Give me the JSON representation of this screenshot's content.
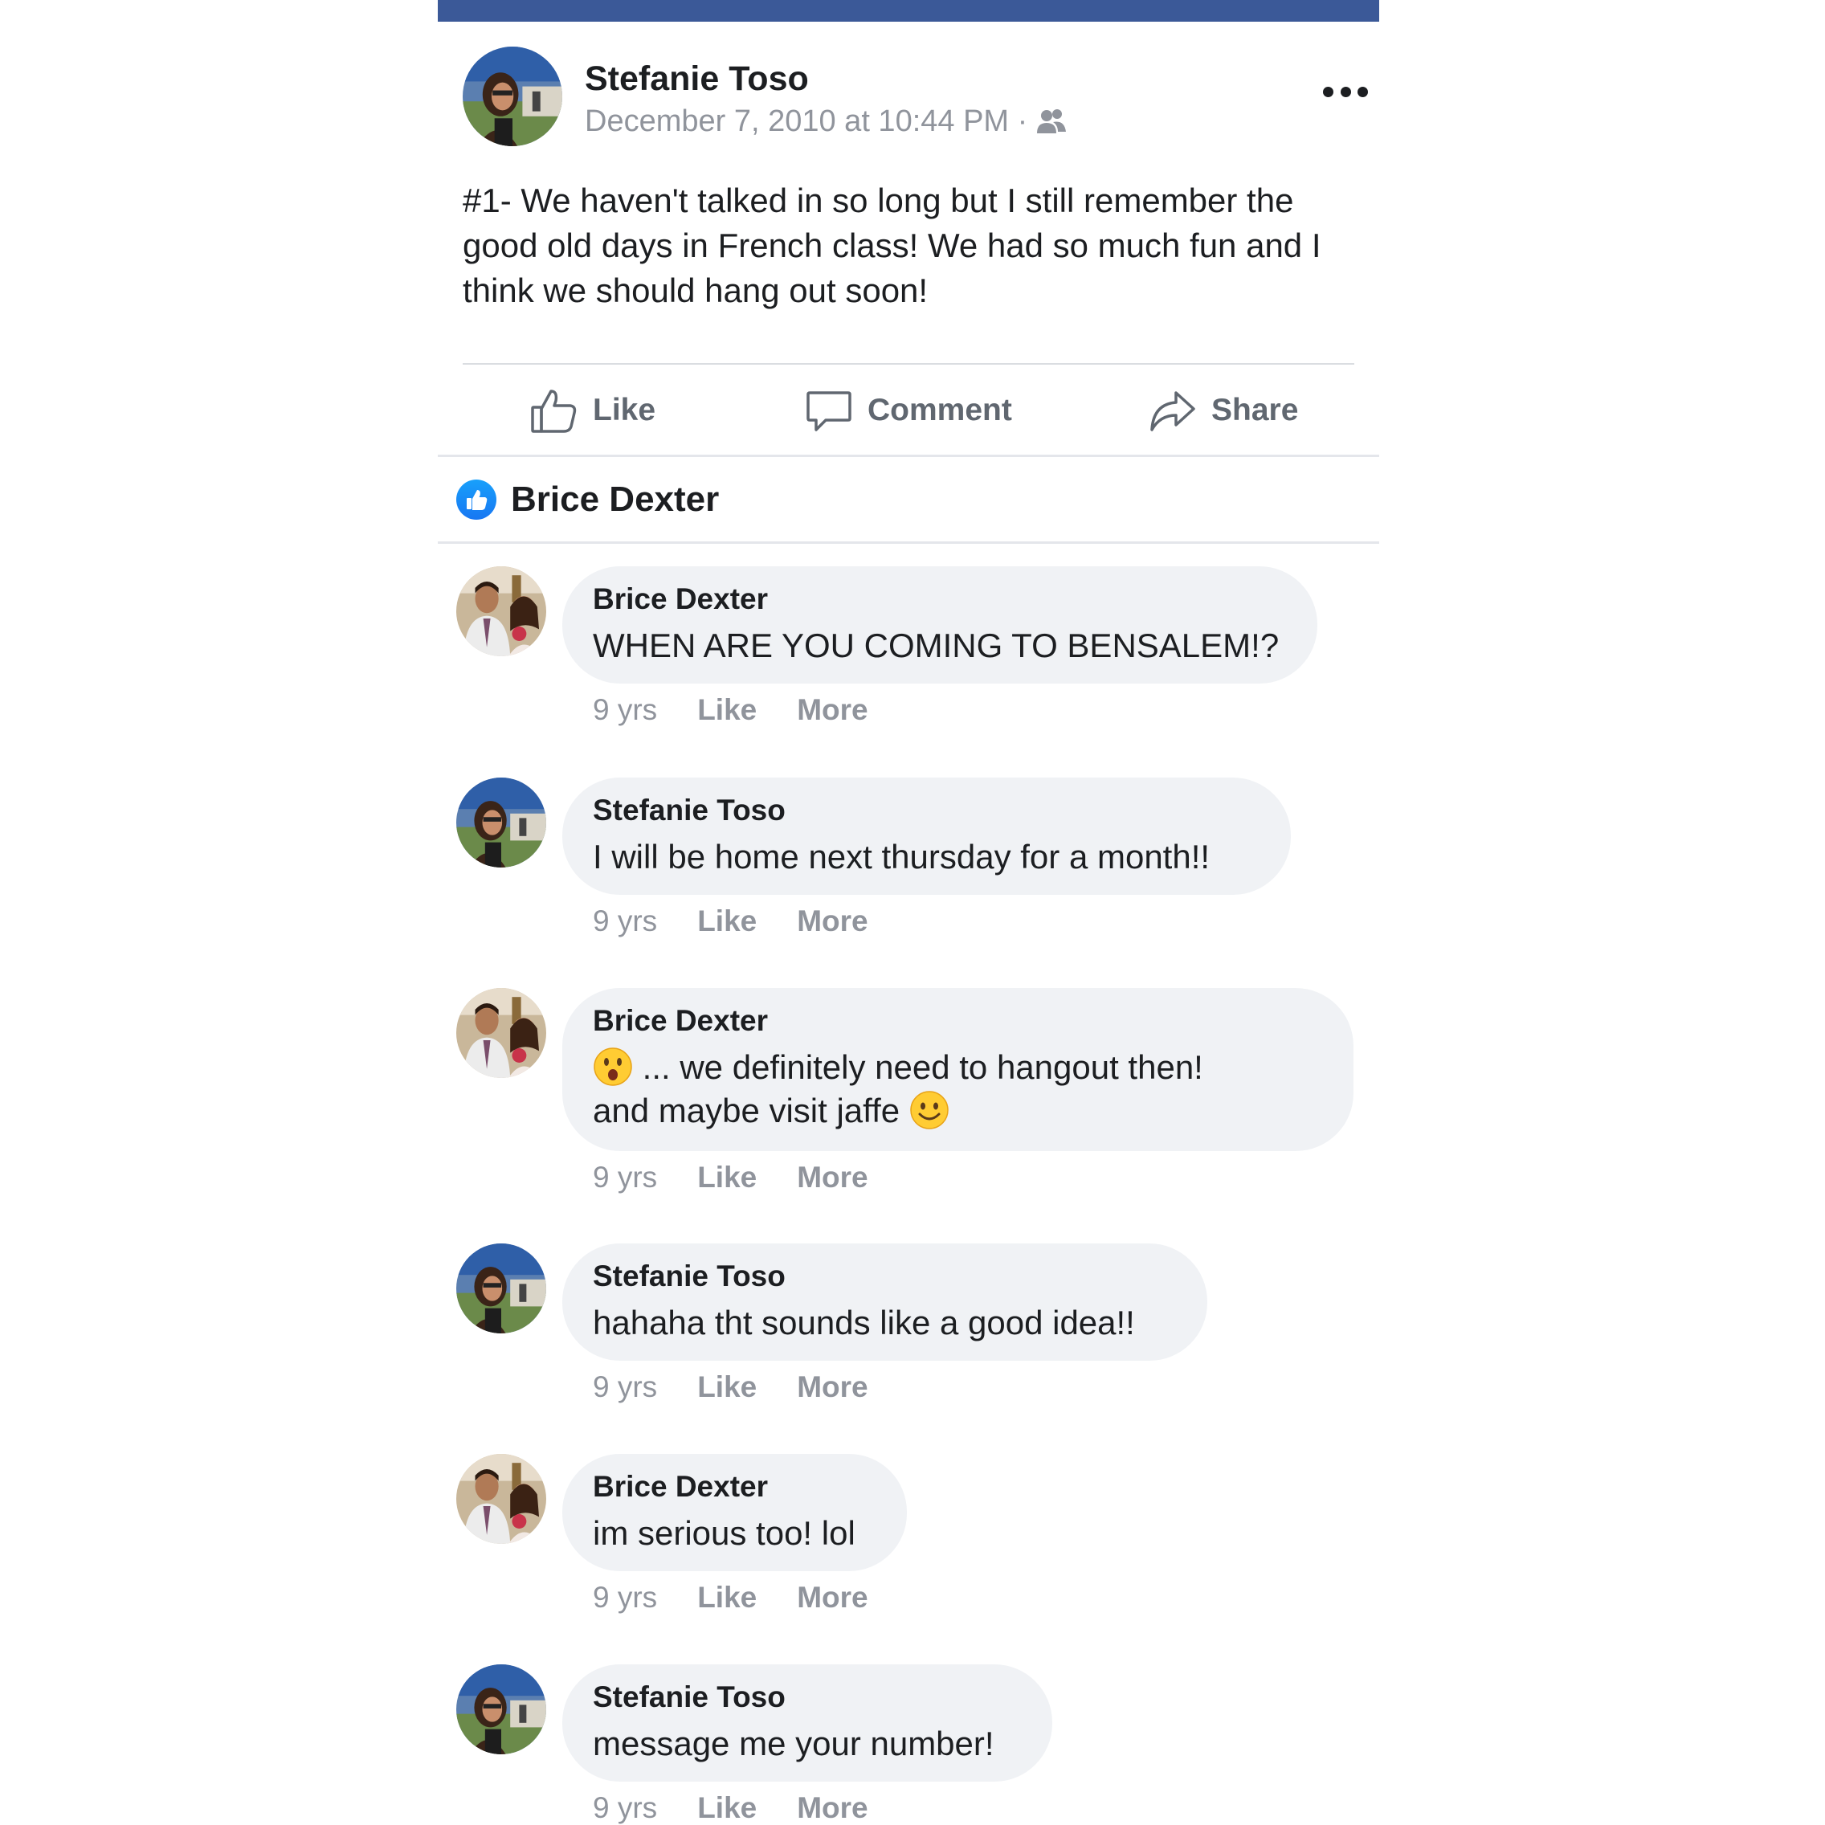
{
  "post": {
    "author": "Stefanie Toso",
    "timestamp": "December 7, 2010 at 10:44 PM ·",
    "audience_icon": "friends-icon",
    "text": "#1- We haven't talked in so long but I still remember the good old days in French class! We had so much fun and I think we should hang out soon!"
  },
  "actions": {
    "like": "Like",
    "comment": "Comment",
    "share": "Share"
  },
  "likes": {
    "icon": "like-reaction-icon",
    "name": "Brice Dexter"
  },
  "comments": [
    {
      "author": "Brice Dexter",
      "text": "WHEN ARE YOU COMING TO BENSALEM!?",
      "age": "9 yrs",
      "like": "Like",
      "more": "More"
    },
    {
      "author": "Stefanie Toso",
      "text": "I will be home next thursday for a month!!",
      "age": "9 yrs",
      "like": "Like",
      "more": "More"
    },
    {
      "author": "Brice Dexter",
      "text_line1": "... we definitely need to hangout then!",
      "text_line2": "and maybe visit jaffe",
      "age": "9 yrs",
      "like": "Like",
      "more": "More"
    },
    {
      "author": "Stefanie Toso",
      "text": "hahaha tht sounds like a good idea!!",
      "age": "9 yrs",
      "like": "Like",
      "more": "More"
    },
    {
      "author": "Brice Dexter",
      "text": "im serious too! lol",
      "age": "9 yrs",
      "like": "Like",
      "more": "More"
    },
    {
      "author": "Stefanie Toso",
      "text": "message me your number!",
      "age": "9 yrs",
      "like": "Like",
      "more": "More"
    }
  ],
  "colors": {
    "header_bar": "#3b5998",
    "bubble_bg": "#f0f2f5",
    "meta_text": "#90949c",
    "like_blue": "#1877f2"
  }
}
